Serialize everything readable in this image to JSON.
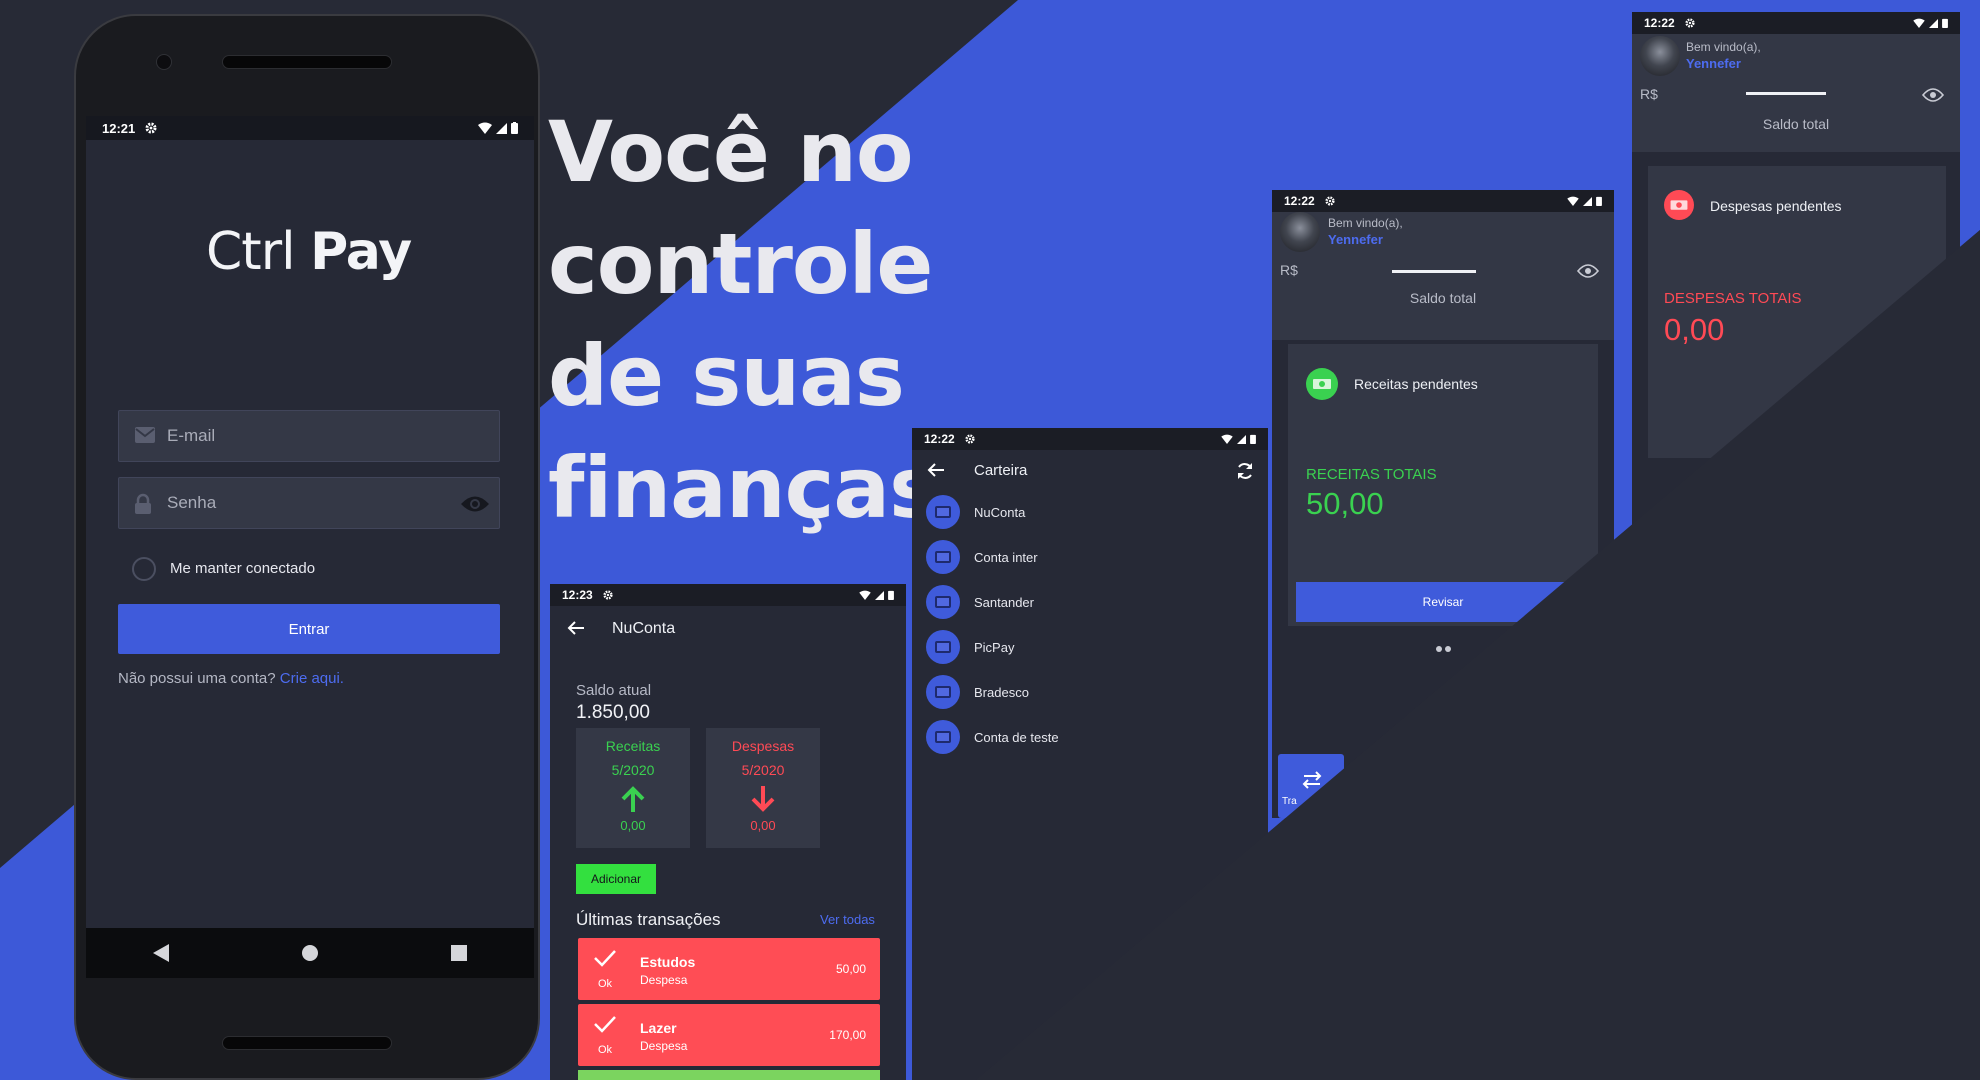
{
  "headline": {
    "line1": "Você no controle",
    "line2": "de suas finanças!"
  },
  "colors": {
    "accent": "#3f5bdb",
    "green": "#3ad150",
    "red": "#ff4a55",
    "bg": "#272a36"
  },
  "login": {
    "time": "12:21",
    "logo_ctrl": "Ctrl",
    "logo_pay": "Pay",
    "email_placeholder": "E-mail",
    "password_placeholder": "Senha",
    "keep_connected": "Me manter conectado",
    "enter": "Entrar",
    "no_account": "Não possui uma conta?",
    "create_here": "Crie aqui."
  },
  "nuconta": {
    "time": "12:23",
    "title": "NuConta",
    "balance_label": "Saldo atual",
    "balance": "1.850,00",
    "income": {
      "label": "Receitas",
      "period": "5/2020",
      "value": "0,00"
    },
    "expense": {
      "label": "Despesas",
      "period": "5/2020",
      "value": "0,00"
    },
    "add": "Adicionar",
    "last_transactions": "Últimas transações",
    "see_all": "Ver todas",
    "transactions": [
      {
        "title": "Estudos",
        "type": "Despesa",
        "value": "50,00",
        "status": "Ok"
      },
      {
        "title": "Lazer",
        "type": "Despesa",
        "value": "170,00",
        "status": "Ok"
      }
    ]
  },
  "wallet": {
    "time": "12:22",
    "title": "Carteira",
    "accounts": [
      "NuConta",
      "Conta inter",
      "Santander",
      "PicPay",
      "Bradesco",
      "Conta de teste"
    ]
  },
  "dashboard1": {
    "time": "12:22",
    "welcome": "Bem vindo(a),",
    "user": "Yennefer",
    "currency": "R$",
    "total_label": "Saldo total",
    "card_title": "Receitas pendentes",
    "total_income_label": "RECEITAS TOTAIS",
    "total_income": "50,00",
    "review": "Revisar",
    "transfer_short": "Tra"
  },
  "dashboard2": {
    "time": "12:22",
    "welcome": "Bem vindo(a),",
    "user": "Yennefer",
    "currency": "R$",
    "total_label": "Saldo total",
    "card_title": "Despesas pendentes",
    "total_expense_label": "DESPESAS TOTAIS",
    "total_expense": "0,00"
  }
}
